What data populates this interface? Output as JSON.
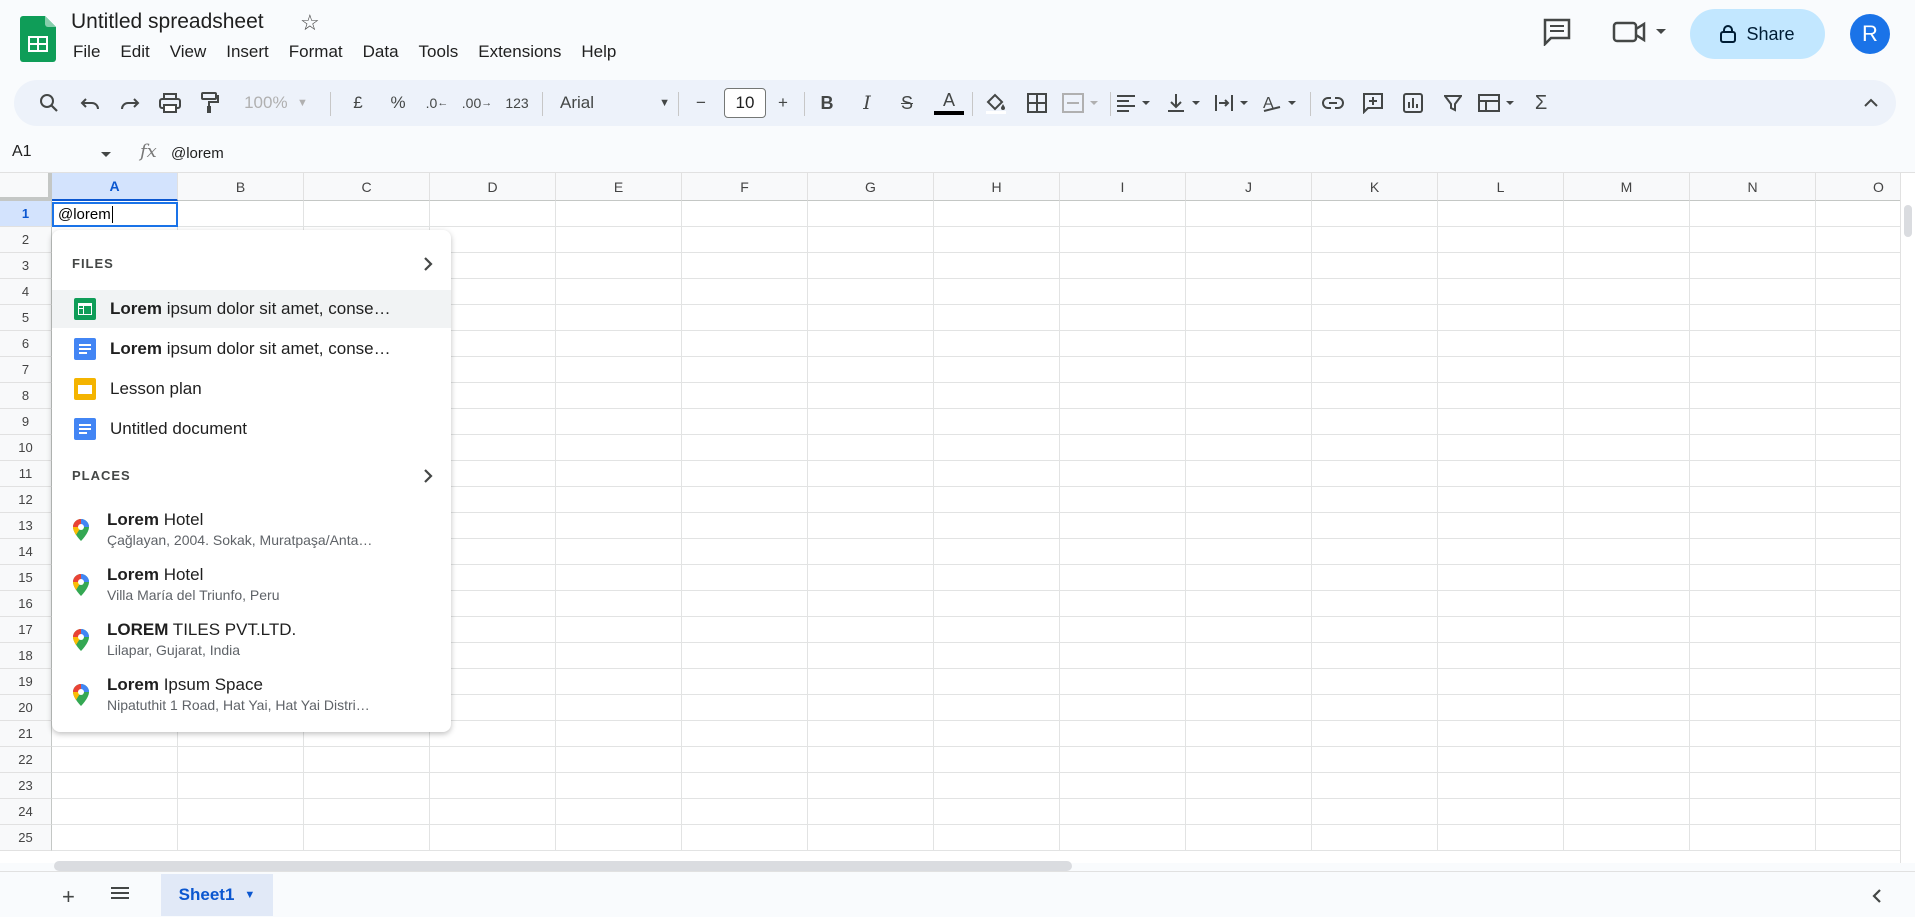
{
  "document": {
    "title": "Untitled spreadsheet"
  },
  "menu": [
    "File",
    "Edit",
    "View",
    "Insert",
    "Format",
    "Data",
    "Tools",
    "Extensions",
    "Help"
  ],
  "share": {
    "label": "Share"
  },
  "avatar": {
    "initial": "R"
  },
  "toolbar": {
    "zoom": "100%",
    "currency": "£",
    "percent": "%",
    "dec_decrease": ".0",
    "dec_increase": ".00",
    "number_format": "123",
    "font": "Arial",
    "font_size": "10",
    "minus": "−",
    "plus": "+",
    "bold": "B",
    "italic": "I",
    "strike": "S",
    "text_color": "A",
    "sum": "Σ"
  },
  "formula_bar": {
    "cell_ref": "A1",
    "fx": "fx",
    "value": "@lorem"
  },
  "grid": {
    "columns": [
      "A",
      "B",
      "C",
      "D",
      "E",
      "F",
      "G",
      "H",
      "I",
      "J",
      "K",
      "L",
      "M",
      "N",
      "O"
    ],
    "rows": [
      "1",
      "2",
      "3",
      "4",
      "5",
      "6",
      "7",
      "8",
      "9",
      "10",
      "11",
      "12",
      "13",
      "14",
      "15",
      "16",
      "17",
      "18",
      "19",
      "20",
      "21",
      "22",
      "23",
      "24",
      "25"
    ],
    "active_cell": "A1",
    "active_value": "@lorem"
  },
  "popup": {
    "files_header": "FILES",
    "places_header": "PLACES",
    "files": [
      {
        "bold": "Lorem",
        "rest": " ipsum dolor sit amet, conse…",
        "type": "sheets-icon"
      },
      {
        "bold": "Lorem",
        "rest": " ipsum dolor sit amet, conse…",
        "type": "docs-icon"
      },
      {
        "bold": "",
        "rest": "Lesson plan",
        "type": "slides-icon"
      },
      {
        "bold": "",
        "rest": "Untitled document",
        "type": "docs-icon"
      }
    ],
    "places": [
      {
        "bold": "Lorem",
        "rest": " Hotel",
        "address": "Çağlayan, 2004. Sokak, Muratpaşa/Anta…"
      },
      {
        "bold": "Lorem",
        "rest": " Hotel",
        "address": "Villa María del Triunfo, Peru"
      },
      {
        "bold": "LOREM",
        "rest": " TILES PVT.LTD.",
        "address": "Lilapar, Gujarat, India"
      },
      {
        "bold": "Lorem",
        "rest": " Ipsum Space",
        "address": "Nipatuthit 1 Road, Hat Yai, Hat Yai Distri…"
      }
    ]
  },
  "sheets": {
    "active": "Sheet1",
    "add": "+"
  },
  "colors": {
    "accent": "#1a73e8",
    "share_bg": "#c2e7ff",
    "toolbar_bg": "#edf2fa",
    "sheets_green": "#0f9d58"
  }
}
